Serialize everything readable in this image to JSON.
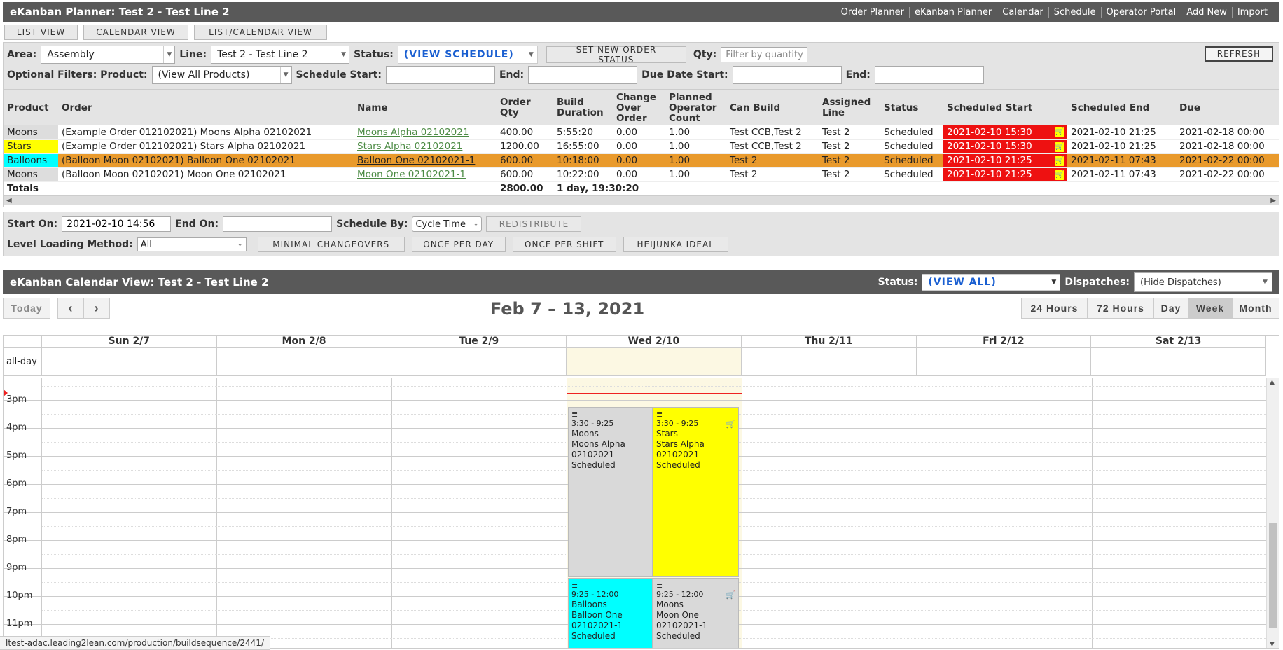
{
  "app": {
    "title": "eKanban Planner: Test 2 - Test Line 2",
    "nav": [
      "Order Planner",
      "eKanban Planner",
      "Calendar",
      "Schedule",
      "Operator Portal",
      "Add New",
      "Import"
    ]
  },
  "view_tabs": [
    "LIST VIEW",
    "CALENDAR VIEW",
    "LIST/CALENDAR VIEW"
  ],
  "filters": {
    "area_label": "Area:",
    "area_value": "Assembly",
    "line_label": "Line:",
    "line_value": "Test 2 - Test Line 2",
    "status_label": "Status:",
    "status_value": "(VIEW SCHEDULE)",
    "set_status_button": "SET NEW ORDER STATUS",
    "qty_label": "Qty:",
    "qty_placeholder": "Filter by quantity",
    "refresh_button": "REFRESH",
    "optional_label": "Optional Filters: Product:",
    "product_value": "(View All Products)",
    "schedule_start_label": "Schedule Start:",
    "end_label": "End:",
    "due_start_label": "Due Date Start:",
    "due_end_label": "End:"
  },
  "orders": {
    "headers": [
      "Product",
      "Order",
      "Name",
      "Order Qty",
      "Build Duration",
      "Change Over Order",
      "Planned Operator Count",
      "Can Build",
      "Assigned Line",
      "Status",
      "Scheduled Start",
      "Scheduled End",
      "Due"
    ],
    "rows": [
      {
        "product": "Moons",
        "order": "(Example Order 012102021) Moons Alpha 02102021",
        "name": "Moons Alpha 02102021",
        "qty": "400.00",
        "duration": "5:55:20",
        "changeover": "0.00",
        "operators": "1.00",
        "can_build": "Test CCB,Test 2",
        "line": "Test 2",
        "status": "Scheduled",
        "start": "2021-02-10 15:30",
        "end": "2021-02-10 21:25",
        "due": "2021-02-18 00:00"
      },
      {
        "product": "Stars",
        "order": "(Example Order 012102021) Stars Alpha 02102021",
        "name": "Stars Alpha 02102021",
        "qty": "1200.00",
        "duration": "16:55:00",
        "changeover": "0.00",
        "operators": "1.00",
        "can_build": "Test CCB,Test 2",
        "line": "Test 2",
        "status": "Scheduled",
        "start": "2021-02-10 15:30",
        "end": "2021-02-10 21:25",
        "due": "2021-02-18 00:00"
      },
      {
        "product": "Balloons",
        "order": "(Balloon Moon 02102021) Balloon One 02102021",
        "name": "Balloon One 02102021-1",
        "qty": "600.00",
        "duration": "10:18:00",
        "changeover": "0.00",
        "operators": "1.00",
        "can_build": "Test 2",
        "line": "Test 2",
        "status": "Scheduled",
        "start": "2021-02-10 21:25",
        "end": "2021-02-11 07:43",
        "due": "2021-02-22 00:00"
      },
      {
        "product": "Moons",
        "order": "(Balloon Moon 02102021) Moon One 02102021",
        "name": "Moon One 02102021-1",
        "qty": "600.00",
        "duration": "10:22:00",
        "changeover": "0.00",
        "operators": "1.00",
        "can_build": "Test 2",
        "line": "Test 2",
        "status": "Scheduled",
        "start": "2021-02-10 21:25",
        "end": "2021-02-11 07:43",
        "due": "2021-02-22 00:00"
      }
    ],
    "totals_label": "Totals",
    "totals_qty": "2800.00",
    "totals_duration": "1 day, 19:30:20"
  },
  "schedule": {
    "start_on_label": "Start On:",
    "start_on_value": "2021-02-10 14:56",
    "end_on_label": "End On:",
    "schedule_by_label": "Schedule By:",
    "schedule_by_value": "Cycle Time",
    "redistribute_button": "REDISTRIBUTE",
    "level_label": "Level Loading Method:",
    "level_value": "All",
    "buttons": [
      "MINIMAL CHANGEOVERS",
      "ONCE PER DAY",
      "ONCE PER SHIFT",
      "HEIJUNKA IDEAL"
    ]
  },
  "calendar": {
    "title": "eKanban Calendar View: Test 2 - Test Line 2",
    "status_label": "Status:",
    "status_value": "(VIEW ALL)",
    "dispatches_label": "Dispatches:",
    "dispatches_value": "(Hide Dispatches)",
    "today_button": "Today",
    "range": "Feb 7 – 13, 2021",
    "views": [
      "24 Hours",
      "72 Hours",
      "Day",
      "Week",
      "Month"
    ],
    "active_view": "Week",
    "days": [
      "Sun 2/7",
      "Mon 2/8",
      "Tue 2/9",
      "Wed 2/10",
      "Thu 2/11",
      "Fri 2/12",
      "Sat 2/13"
    ],
    "allday_label": "all-day",
    "hours": [
      "3pm",
      "4pm",
      "5pm",
      "6pm",
      "7pm",
      "8pm",
      "9pm",
      "10pm",
      "11pm"
    ],
    "events": [
      {
        "time": "3:30 - 9:25",
        "product": "Moons",
        "name": "Moons Alpha 02102021",
        "status": "Scheduled",
        "color": "#d9d9d9"
      },
      {
        "time": "3:30 - 9:25",
        "product": "Stars",
        "name": "Stars Alpha 02102021",
        "status": "Scheduled",
        "color": "#ffff00"
      },
      {
        "time": "9:25 - 12:00",
        "product": "Balloons",
        "name": "Balloon One 02102021-1",
        "status": "Scheduled",
        "color": "#00ffff"
      },
      {
        "time": "9:25 - 12:00",
        "product": "Moons",
        "name": "Moon One 02102021-1",
        "status": "Scheduled",
        "color": "#d9d9d9"
      }
    ]
  },
  "status_url": "ltest-adac.leading2lean.com/production/buildsequence/2441/"
}
